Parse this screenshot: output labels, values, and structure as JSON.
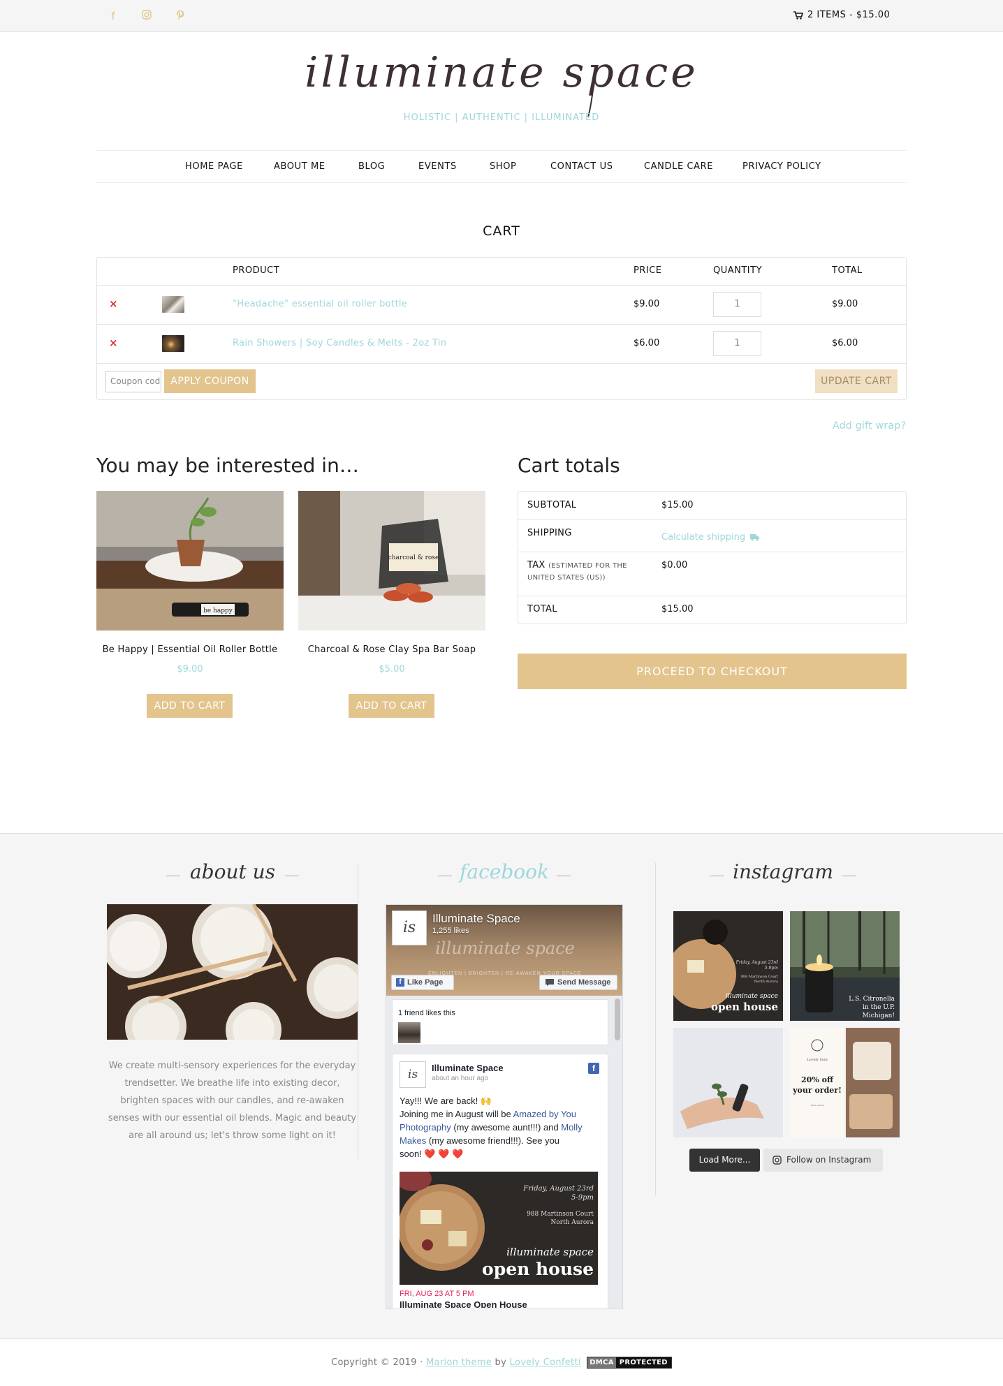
{
  "topbar": {
    "social": [
      "facebook-icon",
      "instagram-icon",
      "pinterest-icon"
    ],
    "cart_summary": "2 ITEMS - $15.00"
  },
  "header": {
    "logo_text": "illuminate space",
    "tagline": "HOLISTIC | AUTHENTIC | ILLUMINATED"
  },
  "nav": [
    "HOME PAGE",
    "ABOUT ME",
    "BLOG",
    "EVENTS",
    "SHOP",
    "CONTACT US",
    "CANDLE CARE",
    "PRIVACY POLICY"
  ],
  "cart": {
    "heading": "CART",
    "columns": {
      "product": "PRODUCT",
      "price": "PRICE",
      "quantity": "QUANTITY",
      "total": "TOTAL"
    },
    "items": [
      {
        "name": "\"Headache\" essential oil roller bottle",
        "price": "$9.00",
        "qty": "1",
        "total": "$9.00"
      },
      {
        "name": "Rain Showers | Soy Candles & Melts - 2oz Tin",
        "price": "$6.00",
        "qty": "1",
        "total": "$6.00"
      }
    ],
    "coupon_placeholder": "Coupon code",
    "apply_coupon": "APPLY COUPON",
    "update_cart": "UPDATE CART",
    "gift_wrap": "Add gift wrap?"
  },
  "related": {
    "title": "You may be interested in…",
    "products": [
      {
        "name": "Be Happy | Essential Oil Roller Bottle",
        "price": "$9.00",
        "button": "ADD TO CART",
        "label": "be happy"
      },
      {
        "name": "Charcoal & Rose Clay Spa Bar Soap",
        "price": "$5.00",
        "button": "ADD TO CART",
        "label": "charcoal & rose"
      }
    ]
  },
  "totals": {
    "title": "Cart totals",
    "subtotal_label": "SUBTOTAL",
    "subtotal": "$15.00",
    "shipping_label": "SHIPPING",
    "shipping_link": "Calculate shipping",
    "tax_label": "TAX",
    "tax_note_1": "(ESTIMATED FOR THE",
    "tax_note_2": "UNITED STATES (US))",
    "tax": "$0.00",
    "total_label": "TOTAL",
    "total": "$15.00",
    "checkout": "PROCEED TO CHECKOUT"
  },
  "footer": {
    "about_title": "about us",
    "about_text": "We create multi-sensory experiences for the everyday trendsetter. We breathe life into existing decor, brighten spaces with our candles, and re-awaken senses with our essential oil blends. Magic and beauty are all around us; let's throw some light on it!",
    "facebook_title": "facebook",
    "instagram_title": "instagram",
    "fb": {
      "page_name": "Illuminate Space",
      "likes": "1,255 likes",
      "cover_text": "illuminate space",
      "cover_subtext": "ENLIGHTEN | BRIGHTEN | RE-AWAKEN YOUR SPACE",
      "like_page": "Like Page",
      "send_message": "Send Message",
      "friend_likes": "1 friend likes this",
      "post_author": "Illuminate Space",
      "post_time": "about an hour ago",
      "post_l1": "Yay!!! We are back! 🙌",
      "post_l2a": "Joining me in August will be ",
      "post_l2b": "Amazed by You",
      "post_l3a": "Photography",
      "post_l3b": " (my awesome aunt!!!) and ",
      "post_l3c": "Molly",
      "post_l4a": "Makes",
      "post_l4b": " (my awesome friend!!!). See you",
      "post_l5": "soon! ❤️ ❤️ ❤️",
      "event_date_text": "Friday, August 23rd",
      "event_time_text": "5-9pm",
      "event_addr1": "988 Martinson Court",
      "event_addr2": "North Aurora",
      "event_brand": "illuminate space",
      "event_title": "open house",
      "event_date": "FRI, AUG 23 AT 5 PM",
      "event_name": "Illuminate Space Open House"
    },
    "ig": {
      "tiles": [
        {
          "line1": "Friday, August 23rd",
          "line2": "5-9pm",
          "line3": "988 Martinson Court",
          "line4": "North Aurora",
          "brand": "illuminate space",
          "title": "open house"
        },
        {
          "line1": "L.S. Citronella",
          "line2": "in the U.P.",
          "line3": "Michigan!"
        },
        {
          "text": ""
        },
        {
          "brand": "Lovely Soul",
          "title": "20% off your order!",
          "small": "Shop now at www.illuminatespace.com coupon code: LOVEOFFER"
        }
      ],
      "load_more": "Load More...",
      "follow": "Follow on Instagram"
    },
    "copyright_prefix": "Copyright © 2019 · ",
    "theme_link": "Marion theme",
    "by": " by ",
    "author_link": "Lovely Confetti",
    "dmca_1": "DMCA",
    "dmca_2": "PROTECTED"
  }
}
